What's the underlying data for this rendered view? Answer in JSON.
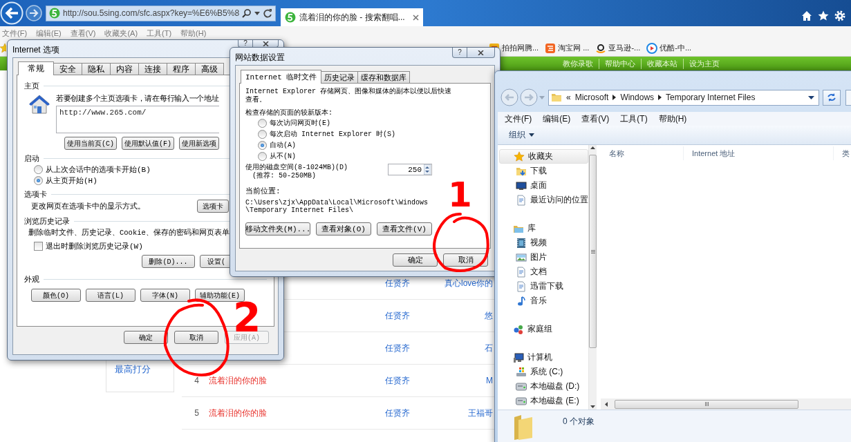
{
  "browser": {
    "address": "http://sou.5sing.com/sfc.aspx?key=%E6%B5%8",
    "tabs": [
      {
        "title": "流着泪的你的脸 - 搜索翻唱...",
        "selected": true
      }
    ],
    "menu": [
      "文件(F)",
      "编辑(E)",
      "查看(V)",
      "收藏夹(A)",
      "工具(T)",
      "帮助(H)"
    ],
    "favorites": [
      "拍拍网腾...",
      "淘宝网 ...",
      "亚马逊-...",
      "优酷-中..."
    ]
  },
  "page": {
    "top_links": [
      "教你录歌",
      "帮助中心",
      "收藏本站",
      "设为主页"
    ],
    "sidebar_link": "最高打分",
    "rows": [
      {
        "singer": "任贤齐",
        "column_4": "真心love你的"
      },
      {
        "singer": "任贤齐",
        "column_4": "悠"
      },
      {
        "singer": "任贤齐",
        "column_4": "石"
      },
      {
        "number": "4",
        "title": "流着泪的你的脸",
        "singer": "任贤齐",
        "column_4": "M"
      },
      {
        "number": "5",
        "title": "流着泪的你的脸",
        "singer": "任贤齐",
        "column_4": "王福哥"
      }
    ]
  },
  "options_dialog": {
    "title": "Internet 选项",
    "help_button": "?",
    "tabs": [
      {
        "label": "常规",
        "selected": true
      },
      {
        "label": "安全",
        "selected": false
      },
      {
        "label": "隐私",
        "selected": false
      },
      {
        "label": "内容",
        "selected": false
      },
      {
        "label": "连接",
        "selected": false
      },
      {
        "label": "程序",
        "selected": false
      },
      {
        "label": "高级",
        "selected": false
      }
    ],
    "homepage": {
      "heading": "主页",
      "hint": "若要创建多个主页选项卡，请在每行输入一个地址",
      "url": "http://www.265.com/",
      "buttons": [
        "使用当前页(C)",
        "使用默认值(F)",
        "使用新选项"
      ]
    },
    "startup": {
      "heading": "启动",
      "options": [
        {
          "label": "从上次会话中的选项卡开始(B)",
          "selected": false
        },
        {
          "label": "从主页开始(H)",
          "selected": true
        }
      ]
    },
    "tabs_group": {
      "heading": "选项卡",
      "text": "更改网页在选项卡中的显示方式。",
      "button": "选项卡"
    },
    "history": {
      "heading": "浏览历史记录",
      "text": "删除临时文件、历史记录、Cookie、保存的密码和网页表单",
      "checkbox": {
        "label": "退出时删除浏览历史记录(W)",
        "checked": false
      },
      "buttons": [
        "删除(D)...",
        "设置("
      ]
    },
    "appearance": {
      "heading": "外观",
      "buttons": [
        "颜色(O)",
        "语言(L)",
        "字体(N)",
        "辅助功能(E)"
      ]
    },
    "buttons": [
      {
        "label": "确定",
        "disabled": false
      },
      {
        "label": "取消",
        "disabled": false
      },
      {
        "label": "应用(A)",
        "disabled": true
      }
    ]
  },
  "cache_dialog": {
    "title": "网站数据设置",
    "help_button": "?",
    "tabs": [
      {
        "label": "Internet 临时文件",
        "selected": true
      },
      {
        "label": "历史记录",
        "selected": false
      },
      {
        "label": "缓存和数据库",
        "selected": false
      }
    ],
    "description": "Internet Explorer 存储网页、图像和媒体的副本以便以后快速查看。",
    "check_label": "检查存储的页面的较新版本:",
    "options": [
      {
        "label": "每次访问网页时(E)",
        "selected": false
      },
      {
        "label": "每次启动 Internet Explorer 时(S)",
        "selected": false
      },
      {
        "label": "自动(A)",
        "selected": true
      },
      {
        "label": "从不(N)",
        "selected": false
      }
    ],
    "disk_label": "使用的磁盘空间(8-1024MB)(D)",
    "disk_hint": "(推荐: 50-250MB)",
    "disk_value": "250",
    "location_label": "当前位置:",
    "location": "C:\\Users\\zjx\\AppData\\Local\\Microsoft\\Windows\\Temporary Internet Files\\",
    "actions": [
      "移动文件夹(M)...",
      "查看对象(O)",
      "查看文件(V)"
    ],
    "buttons": [
      "确定",
      "取消"
    ]
  },
  "explorer": {
    "path_prefix": "«",
    "path": [
      "Microsoft",
      "Windows",
      "Temporary Internet Files"
    ],
    "menu": [
      "文件(F)",
      "编辑(E)",
      "查看(V)",
      "工具(T)",
      "帮助(H)"
    ],
    "organize": "组织",
    "tree": [
      {
        "label": "收藏夹",
        "selected": true,
        "children": [
          {
            "label": "下载",
            "selected": false
          },
          {
            "label": "桌面",
            "selected": false
          },
          {
            "label": "最近访问的位置",
            "selected": false
          }
        ]
      },
      {
        "label": "库",
        "selected": false,
        "children": [
          {
            "label": "视频",
            "selected": false
          },
          {
            "label": "图片",
            "selected": false
          },
          {
            "label": "文档",
            "selected": false
          },
          {
            "label": "迅雷下载",
            "selected": false
          },
          {
            "label": "音乐",
            "selected": false
          }
        ]
      },
      {
        "label": "家庭组",
        "selected": false
      },
      {
        "label": "计算机",
        "selected": false,
        "children": [
          {
            "label": "系统 (C:)",
            "selected": false
          },
          {
            "label": "本地磁盘 (D:)",
            "selected": false
          },
          {
            "label": "本地磁盘 (E:)",
            "selected": false
          }
        ]
      }
    ],
    "columns": [
      "名称",
      "Internet 地址",
      "类"
    ],
    "status": "0 个对象"
  },
  "annotations": [
    {
      "label": "1"
    },
    {
      "label": "2"
    }
  ]
}
